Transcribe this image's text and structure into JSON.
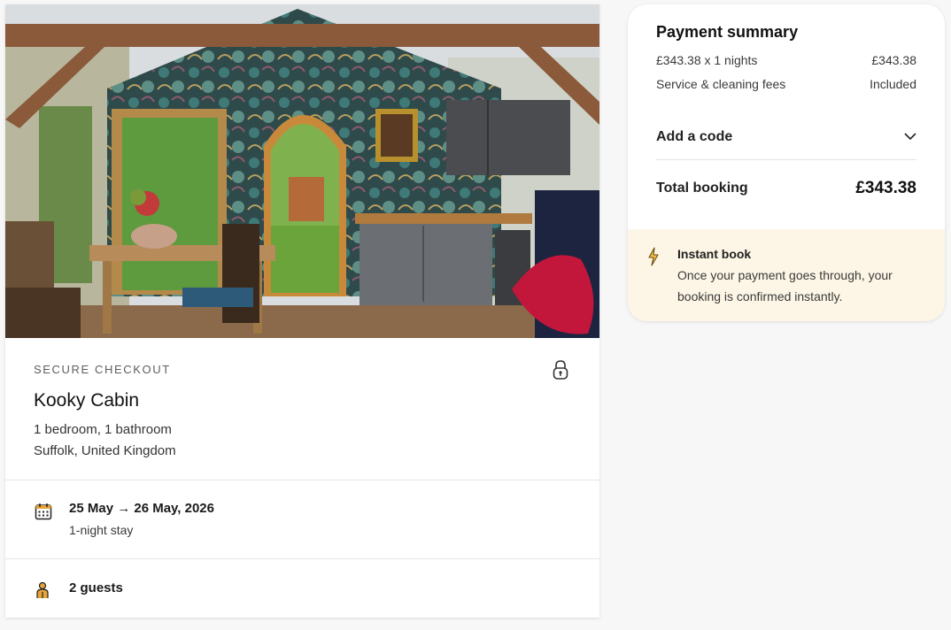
{
  "listing": {
    "photo_alt": "kitchen-dining-room-photo",
    "eyebrow": "SECURE CHECKOUT",
    "name": "Kooky Cabin",
    "rooms": "1 bedroom, 1 bathroom",
    "location": "Suffolk, United Kingdom",
    "lock_icon": "lock-icon"
  },
  "stay": {
    "dates": "25 May → 26 May, 2026",
    "length": "1-night stay",
    "calendar_icon": "calendar-icon"
  },
  "guests": {
    "count": "2 guests",
    "icon": "person-icon"
  },
  "summary": {
    "title": "Payment summary",
    "nightly_label": "£343.38 x 1 nights",
    "nightly_value": "£343.38",
    "fees_label": "Service & cleaning fees",
    "fees_value": "Included",
    "code_label": "Add a code",
    "total_label": "Total booking",
    "total_value": "£343.38"
  },
  "instant": {
    "title": "Instant book",
    "body": "Once your payment goes through, your booking is confirmed instantly.",
    "icon": "lightning-icon"
  },
  "colors": {
    "page_bg": "#f7f7f7",
    "card_bg": "#ffffff",
    "instant_bg": "#fdf6e6",
    "accent_icon": "#c98a1a"
  }
}
